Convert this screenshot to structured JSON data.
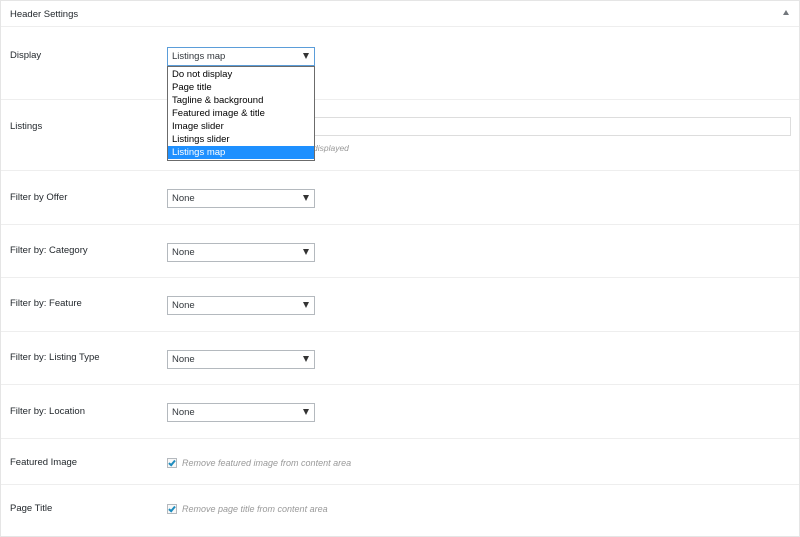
{
  "panel": {
    "title": "Header Settings"
  },
  "display": {
    "label": "Display",
    "selected": "Listings map",
    "options": [
      "Do not display",
      "Page title",
      "Tagline & background",
      "Featured image & title",
      "Image slider",
      "Listings slider",
      "Listings map"
    ],
    "highlighted_index": 6
  },
  "listings": {
    "label": "Listings",
    "hint": "displayed"
  },
  "filters": [
    {
      "label": "Filter by Offer",
      "value": "None"
    },
    {
      "label": "Filter by: Category",
      "value": "None"
    },
    {
      "label": "Filter by: Feature",
      "value": "None"
    },
    {
      "label": "Filter by: Listing Type",
      "value": "None"
    },
    {
      "label": "Filter by: Location",
      "value": "None"
    }
  ],
  "featured_image": {
    "label": "Featured Image",
    "checkbox_label": "Remove featured image from content area",
    "checked": true
  },
  "page_title": {
    "label": "Page Title",
    "checkbox_label": "Remove page title from content area",
    "checked": true
  },
  "colors": {
    "accent": "#1e90ff",
    "check": "#1e8cbe",
    "border": "#b4b9be"
  }
}
